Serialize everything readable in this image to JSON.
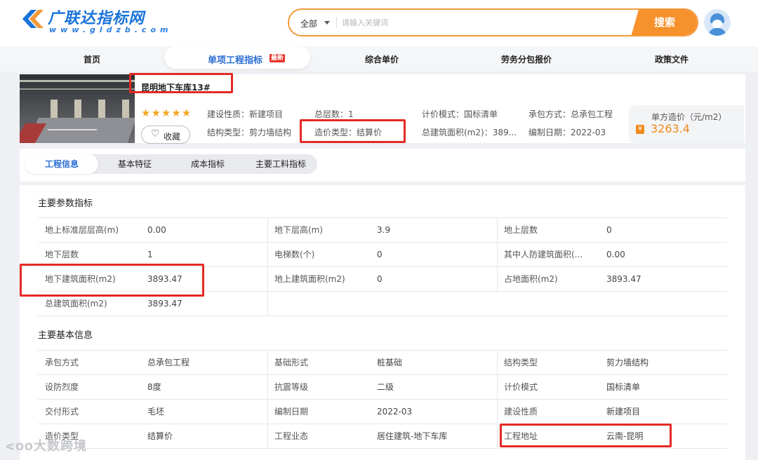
{
  "header": {
    "brand": "广联达指标网",
    "url": "www.gldzb.com",
    "search_scope": "全部",
    "search_placeholder": "请输入关键词",
    "search_button": "搜索"
  },
  "nav": {
    "items": [
      "首页",
      "单项工程指标",
      "综合单价",
      "劳务分包报价",
      "政策文件"
    ],
    "active_badge": "最新"
  },
  "project": {
    "title": "昆明地下车库13#",
    "stars": "★★★★★",
    "favorite_label": "收藏",
    "attrs": {
      "build_nature": "建设性质：新建项目",
      "total_floors": "总层数：1",
      "pricing_mode": "计价模式：国标清单",
      "contract_mode": "承包方式：总承包工程",
      "structure_type": "结构类型：剪力墙结构",
      "cost_type": "造价类型：结算价",
      "total_area": "总建筑面积(m2)：389...",
      "compile_date": "编制日期：2022-03"
    },
    "unit_price_label": "单方造价（元/m2）",
    "unit_price_value": "3263.4"
  },
  "tabs": [
    "工程信息",
    "基本特征",
    "成本指标",
    "主要工料指标"
  ],
  "main_params": {
    "title": "主要参数指标",
    "rows": [
      [
        [
          "地上标准层层高(m)",
          "0.00"
        ],
        [
          "地下层高(m)",
          "3.9"
        ],
        [
          "地上层数",
          "0"
        ]
      ],
      [
        [
          "地下层数",
          "1"
        ],
        [
          "电梯数(个)",
          "0"
        ],
        [
          "其中人防建筑面积(...",
          "0.00"
        ]
      ],
      [
        [
          "地下建筑面积(m2)",
          "3893.47"
        ],
        [
          "地上建筑面积(m2)",
          "0"
        ],
        [
          "占地面积(m2)",
          "3893.47"
        ]
      ],
      [
        [
          "总建筑面积(m2)",
          "3893.47"
        ]
      ]
    ]
  },
  "basic_info": {
    "title": "主要基本信息",
    "rows": [
      [
        [
          "承包方式",
          "总承包工程"
        ],
        [
          "基础形式",
          "桩基础"
        ],
        [
          "结构类型",
          "剪力墙结构"
        ]
      ],
      [
        [
          "设防烈度",
          "8度"
        ],
        [
          "抗震等级",
          "二级"
        ],
        [
          "计价模式",
          "国标清单"
        ]
      ],
      [
        [
          "交付形式",
          "毛坯"
        ],
        [
          "编制日期",
          "2022-03"
        ],
        [
          "建设性质",
          "新建项目"
        ]
      ],
      [
        [
          "造价类型",
          "结算价"
        ],
        [
          "工程业态",
          "居住建筑-地下车库"
        ],
        [
          "工程地址",
          "云南-昆明"
        ]
      ]
    ]
  },
  "watermark": "大数跨境",
  "colors": {
    "accent": "#2d6fd3",
    "orange": "#f7912c",
    "annotation": "#e42a24"
  }
}
